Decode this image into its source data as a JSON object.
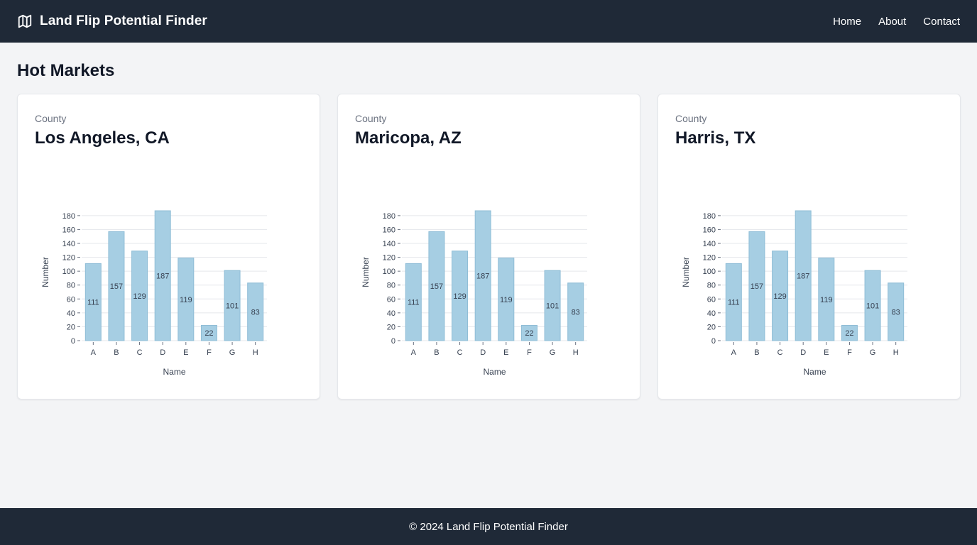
{
  "app": {
    "title": "Land Flip Potential Finder",
    "brand_icon": "map-icon"
  },
  "nav": {
    "links": [
      {
        "label": "Home"
      },
      {
        "label": "About"
      },
      {
        "label": "Contact"
      }
    ]
  },
  "main": {
    "title": "Hot Markets"
  },
  "cards": [
    {
      "kicker": "County",
      "title": "Los Angeles, CA"
    },
    {
      "kicker": "County",
      "title": "Maricopa, AZ"
    },
    {
      "kicker": "County",
      "title": "Harris, TX"
    }
  ],
  "chart_data": [
    {
      "type": "bar",
      "categories": [
        "A",
        "B",
        "C",
        "D",
        "E",
        "F",
        "G",
        "H"
      ],
      "values": [
        111,
        157,
        129,
        187,
        119,
        22,
        101,
        83
      ],
      "xlabel": "Name",
      "ylabel": "Number",
      "ylim": [
        0,
        187
      ],
      "yticks": [
        0,
        20,
        40,
        60,
        80,
        100,
        120,
        140,
        160,
        180
      ],
      "grid": true,
      "bar_color": "#a6cee3"
    },
    {
      "type": "bar",
      "categories": [
        "A",
        "B",
        "C",
        "D",
        "E",
        "F",
        "G",
        "H"
      ],
      "values": [
        111,
        157,
        129,
        187,
        119,
        22,
        101,
        83
      ],
      "xlabel": "Name",
      "ylabel": "Number",
      "ylim": [
        0,
        187
      ],
      "yticks": [
        0,
        20,
        40,
        60,
        80,
        100,
        120,
        140,
        160,
        180
      ],
      "grid": true,
      "bar_color": "#a6cee3"
    },
    {
      "type": "bar",
      "categories": [
        "A",
        "B",
        "C",
        "D",
        "E",
        "F",
        "G",
        "H"
      ],
      "values": [
        111,
        157,
        129,
        187,
        119,
        22,
        101,
        83
      ],
      "xlabel": "Name",
      "ylabel": "Number",
      "ylim": [
        0,
        187
      ],
      "yticks": [
        0,
        20,
        40,
        60,
        80,
        100,
        120,
        140,
        160,
        180
      ],
      "grid": true,
      "bar_color": "#a6cee3"
    }
  ],
  "footer": {
    "text": "© 2024 Land Flip Potential Finder"
  },
  "colors": {
    "navbar_bg": "#1f2937",
    "page_bg": "#f3f4f6",
    "bar": "#a6cee3",
    "bar_stroke": "#8fbdd6",
    "grid": "#e5e7eb"
  }
}
